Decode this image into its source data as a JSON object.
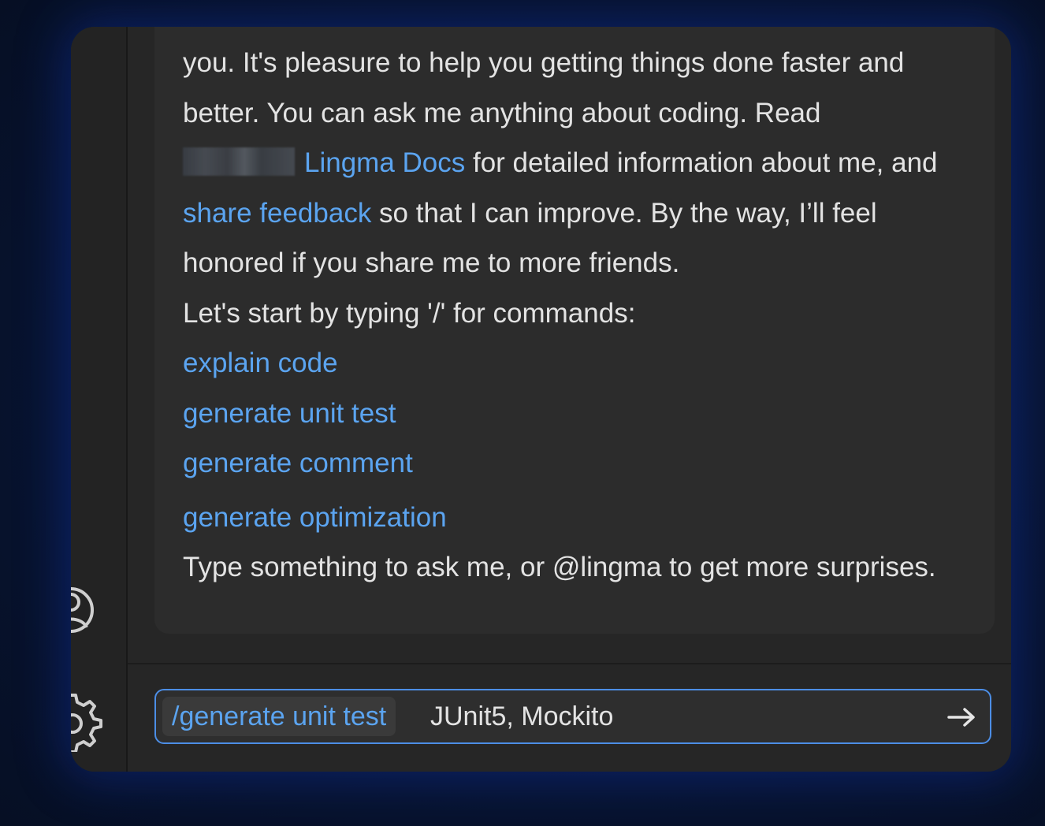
{
  "message": {
    "line1": "you. It's pleasure to help you getting things done faster and better. You can ask me anything about coding. Read",
    "docs_link": "Lingma Docs",
    "line2": " for detailed information about me, and ",
    "feedback_link": "share feedback",
    "line3": " so that I can improve. By the way, I’ll feel honored if you share me to more friends.",
    "commands_intro": "Let's start by typing '/' for commands:",
    "commands": [
      "explain code",
      "generate unit test",
      "generate comment",
      "generate optimization"
    ],
    "outro": "Type something to ask me, or @lingma to get more surprises."
  },
  "input": {
    "command_chip": "/generate unit test",
    "value": "JUnit5, Mockito"
  },
  "icons": {
    "user": "user-icon",
    "settings": "gear-icon",
    "send": "arrow-right-icon"
  },
  "colors": {
    "link": "#5ba4f0",
    "input_border": "#4c8ee6",
    "text": "#e3e3e3",
    "panel": "#262626"
  }
}
